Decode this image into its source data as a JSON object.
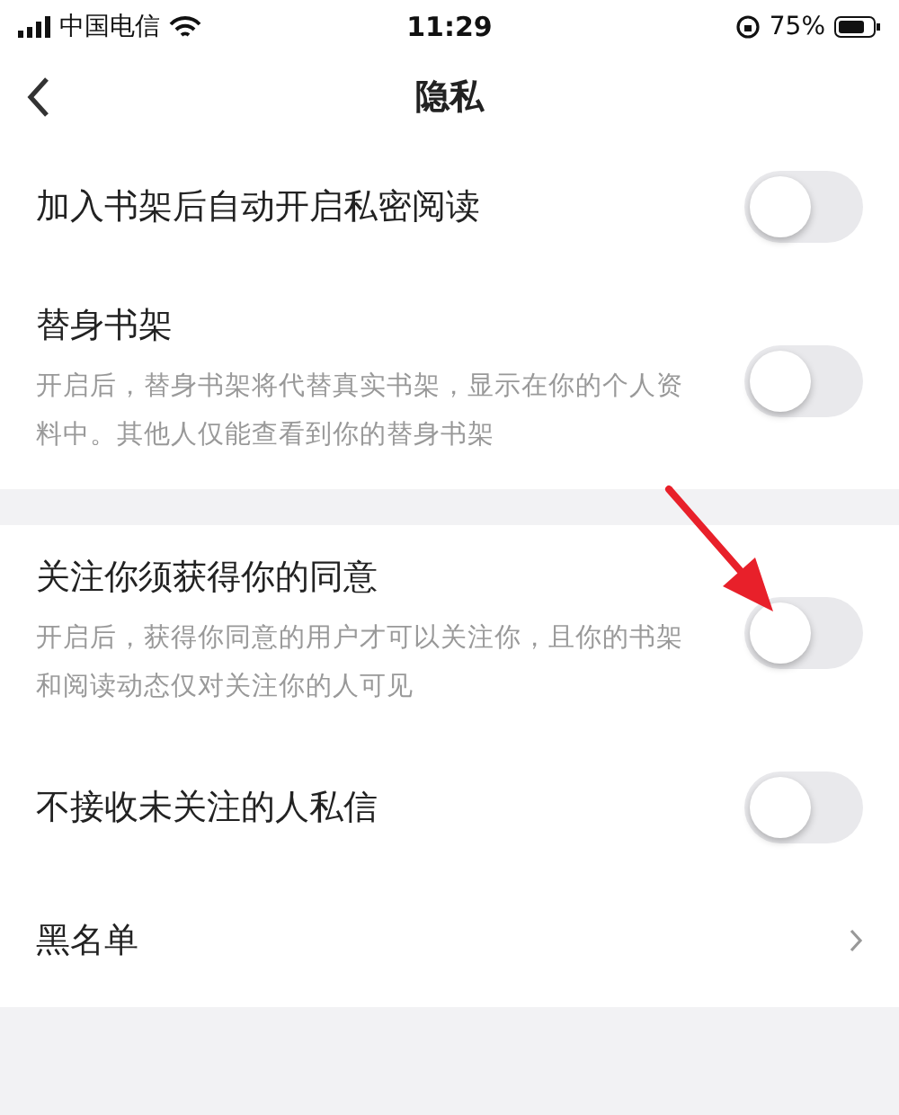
{
  "status_bar": {
    "carrier": "中国电信",
    "time": "11:29",
    "battery": "75%"
  },
  "nav": {
    "title": "隐私"
  },
  "sections": [
    {
      "items": [
        {
          "kind": "toggle",
          "title": "加入书架后自动开启私密阅读",
          "on": false
        },
        {
          "kind": "toggle",
          "title": "替身书架",
          "description": "开启后，替身书架将代替真实书架，显示在你的个人资料中。其他人仅能查看到你的替身书架",
          "on": false
        }
      ]
    },
    {
      "items": [
        {
          "kind": "toggle",
          "title": "关注你须获得你的同意",
          "description": "开启后，获得你同意的用户才可以关注你，且你的书架和阅读动态仅对关注你的人可见",
          "on": false
        },
        {
          "kind": "toggle",
          "title": "不接收未关注的人私信",
          "on": false
        },
        {
          "kind": "link",
          "title": "黑名单"
        }
      ]
    }
  ],
  "annotation": {
    "kind": "arrow"
  }
}
